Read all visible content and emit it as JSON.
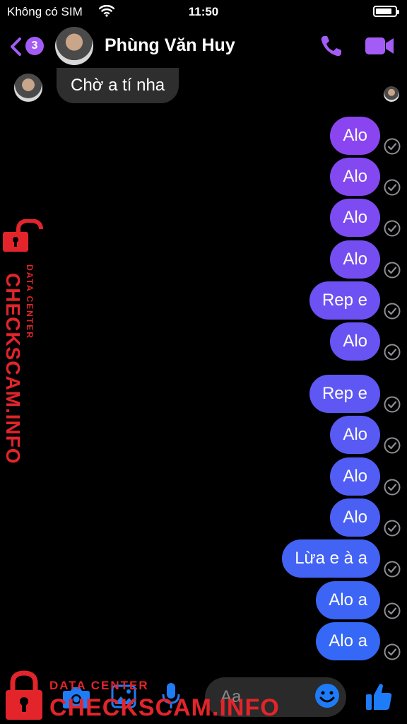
{
  "status_bar": {
    "carrier": "Không có SIM",
    "time": "11:50",
    "battery_level": 0.85
  },
  "header": {
    "back_badge_count": "3",
    "contact_name": "Phùng Văn Huy"
  },
  "incoming": {
    "text": "Chờ a tí nha"
  },
  "messages": [
    {
      "text": "Alo"
    },
    {
      "text": "Alo"
    },
    {
      "text": "Alo"
    },
    {
      "text": "Alo"
    },
    {
      "text": "Rep e"
    },
    {
      "text": "Alo"
    },
    {
      "text": "Rep e"
    },
    {
      "text": "Alo"
    },
    {
      "text": "Alo"
    },
    {
      "text": "Alo"
    },
    {
      "text": "Lừa e à a"
    },
    {
      "text": "Alo a"
    },
    {
      "text": "Alo a"
    }
  ],
  "composer": {
    "placeholder": "Aa"
  },
  "watermark": {
    "subtitle": "DATA CENTER",
    "brand": "CHECKSCAM.INFO"
  },
  "colors": {
    "accent": "#a35cf5",
    "bubble_top": "#8b45f0",
    "bubble_bottom": "#2e6bf6",
    "incoming_bubble": "#2e2e2e",
    "watermark": "#e3242b"
  }
}
